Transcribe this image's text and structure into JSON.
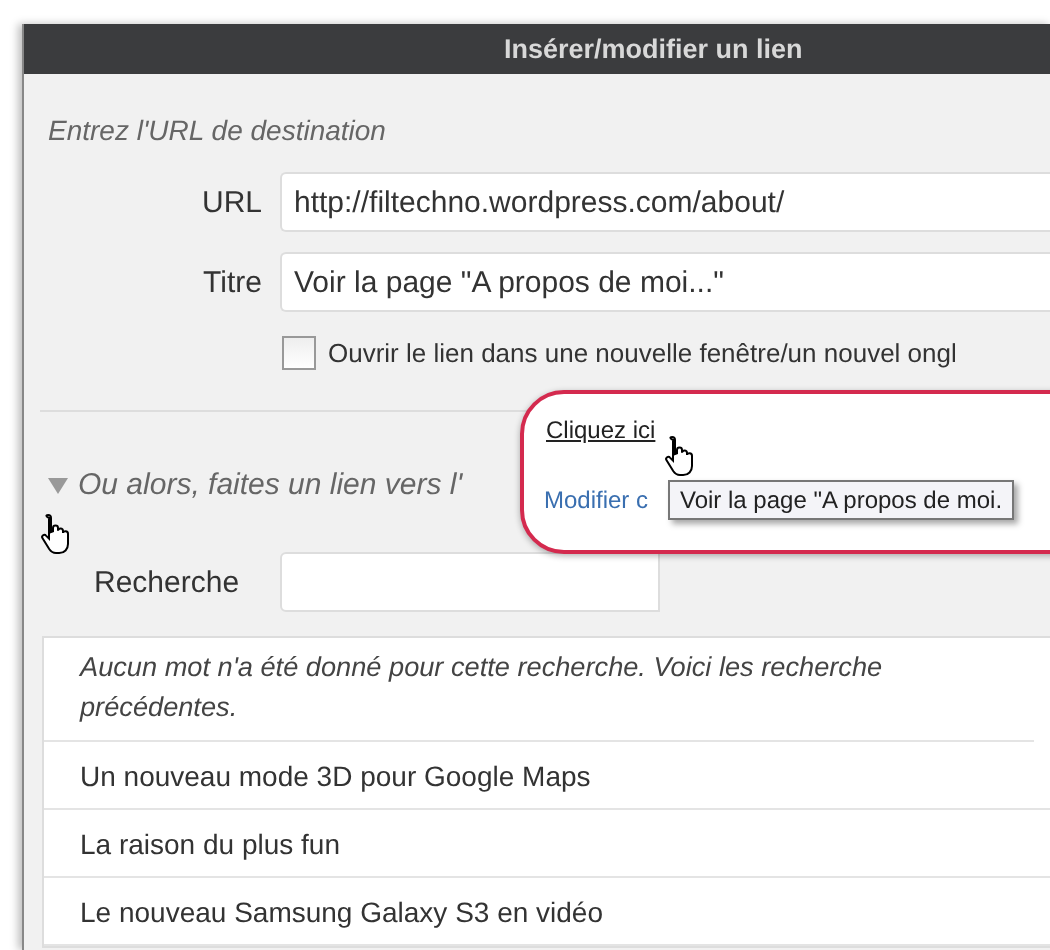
{
  "dialog": {
    "title": "Insérer/modifier un lien",
    "hint": "Entrez l'URL de destination",
    "fields": [
      {
        "label": "URL",
        "value": "http://filtechno.wordpress.com/about/"
      },
      {
        "label": "Titre",
        "value": "Voir la page \"A propos de moi...\""
      }
    ],
    "new_tab": {
      "label": "Ouvrir le lien dans une nouvelle fenêtre/un nouvel ongl",
      "checked": false
    },
    "link_existing": {
      "label": "Ou alors, faites un lien vers l'",
      "expanded": true
    },
    "search": {
      "label": "Recherche"
    },
    "results": {
      "notice": "Aucun mot n'a été donné pour cette recherche. Voici les recherche précédentes.",
      "items": [
        "Un nouveau mode 3D pour Google Maps",
        "La raison du plus fun",
        "Le nouveau Samsung Galaxy S3 en vidéo"
      ]
    }
  },
  "callout": {
    "link": "Cliquez ici",
    "link_2": "Modifier c",
    "tooltip": "Voir la page \"A propos de moi."
  }
}
